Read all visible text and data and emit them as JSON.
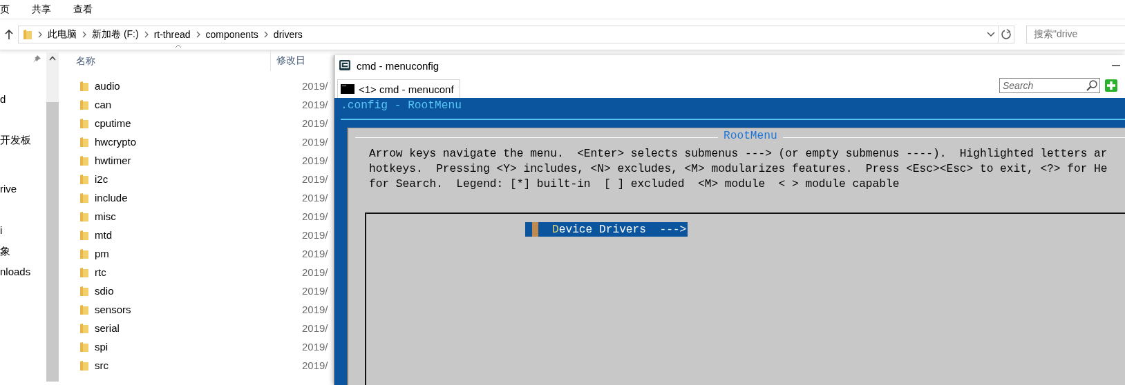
{
  "explorer": {
    "ribbon_tabs": [
      "页",
      "共享",
      "查看"
    ],
    "breadcrumb": [
      "此电脑",
      "新加卷 (F:)",
      "rt-thread",
      "components",
      "drivers"
    ],
    "search": {
      "placeholder": "搜索\"drive"
    },
    "nav_items": [
      "d",
      "开发板",
      "rive",
      "i",
      "象",
      "nloads"
    ],
    "columns": [
      "名称",
      "修改日"
    ],
    "files": [
      {
        "name": "audio",
        "date": "2019/"
      },
      {
        "name": "can",
        "date": "2019/"
      },
      {
        "name": "cputime",
        "date": "2019/"
      },
      {
        "name": "hwcrypto",
        "date": "2019/"
      },
      {
        "name": "hwtimer",
        "date": "2019/"
      },
      {
        "name": "i2c",
        "date": "2019/"
      },
      {
        "name": "include",
        "date": "2019/"
      },
      {
        "name": "misc",
        "date": "2019/"
      },
      {
        "name": "mtd",
        "date": "2019/"
      },
      {
        "name": "pm",
        "date": "2019/"
      },
      {
        "name": "rtc",
        "date": "2019/"
      },
      {
        "name": "sdio",
        "date": "2019/"
      },
      {
        "name": "sensors",
        "date": "2019/"
      },
      {
        "name": "serial",
        "date": "2019/"
      },
      {
        "name": "spi",
        "date": "2019/"
      },
      {
        "name": "src",
        "date": "2019/"
      }
    ]
  },
  "cmd_window": {
    "title": "cmd - menuconfig",
    "tabs": [
      {
        "label": "<1> cmd - menuconf",
        "selected": true
      }
    ],
    "search": {
      "placeholder": "Search"
    },
    "header": ".config - RootMenu",
    "dialog": {
      "title": "RootMenu",
      "help_lines": [
        "Arrow keys navigate the menu.  <Enter> selects submenus ---> (or empty submenus ----).  Highlighted letters ar",
        "hotkeys.  Pressing <Y> includes, <N> excludes, <M> modularizes features.  Press <Esc><Esc> to exit, <?> for He",
        "for Search.  Legend: [*] built-in  [ ] excluded  <M> module  < > module capable"
      ],
      "menu_items": [
        {
          "label": "Device Drivers  --->",
          "selected": true
        }
      ]
    }
  }
}
